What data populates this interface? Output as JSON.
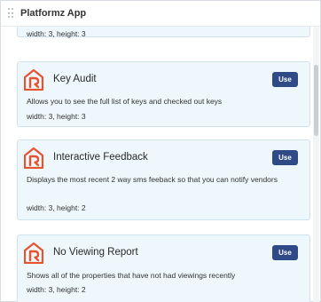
{
  "app": {
    "title": "Platformz App"
  },
  "widgets": [
    {
      "name": "",
      "description": "",
      "size": "width: 3, height: 3",
      "use_label": ""
    },
    {
      "name": "Key Audit",
      "description": "Allows you to see the full list of keys and checked out keys",
      "size": "width: 3, height: 3",
      "use_label": "Use"
    },
    {
      "name": "Interactive Feedback",
      "description": "Displays the most recent 2 way sms feeback so that you can notify vendors",
      "size": "width: 3, height: 2",
      "use_label": "Use"
    },
    {
      "name": "No Viewing Report",
      "description": "Shows all of the properties that have not had viewings recently",
      "size": "width: 3, height: 2",
      "use_label": "Use"
    }
  ],
  "colors": {
    "accent": "#2f4a86",
    "logo": "#e8532f",
    "card_bg": "#eef7fb"
  }
}
